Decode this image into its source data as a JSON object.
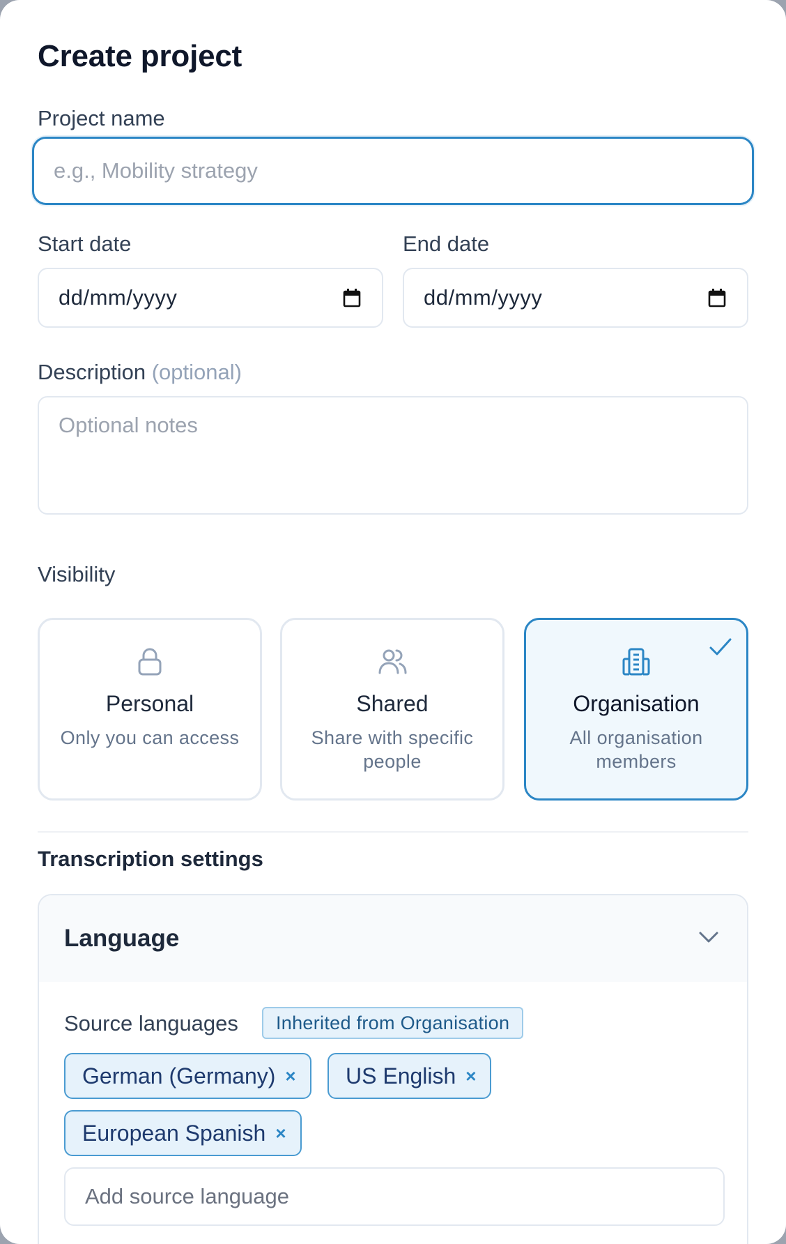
{
  "modal": {
    "title": "Create project"
  },
  "project_name": {
    "label": "Project name",
    "placeholder": "e.g., Mobility strategy",
    "value": ""
  },
  "start_date": {
    "label": "Start date",
    "value": "dd/mm/yyyy"
  },
  "end_date": {
    "label": "End date",
    "value": "dd/mm/yyyy"
  },
  "description": {
    "label": "Description",
    "optional_label": "(optional)",
    "placeholder": "Optional notes"
  },
  "visibility": {
    "label": "Visibility",
    "selected": "Organisation",
    "options": [
      {
        "title": "Personal",
        "desc": "Only you can access",
        "icon": "lock-icon"
      },
      {
        "title": "Shared",
        "desc": "Share with specific people",
        "icon": "users-icon"
      },
      {
        "title": "Organisation",
        "desc": "All organisation members",
        "icon": "building-icon"
      }
    ]
  },
  "transcription": {
    "section_title": "Transcription settings",
    "panel_title": "Language",
    "source_label": "Source languages",
    "inherited_badge": "Inherited from Organisation",
    "languages": [
      "German (Germany)",
      "US English",
      "European Spanish"
    ],
    "remove_glyph": "×",
    "add_placeholder": "Add source language"
  },
  "colors": {
    "accent": "#2b86c5",
    "selected_bg": "#f0f8fd",
    "title": "#0f172a"
  }
}
